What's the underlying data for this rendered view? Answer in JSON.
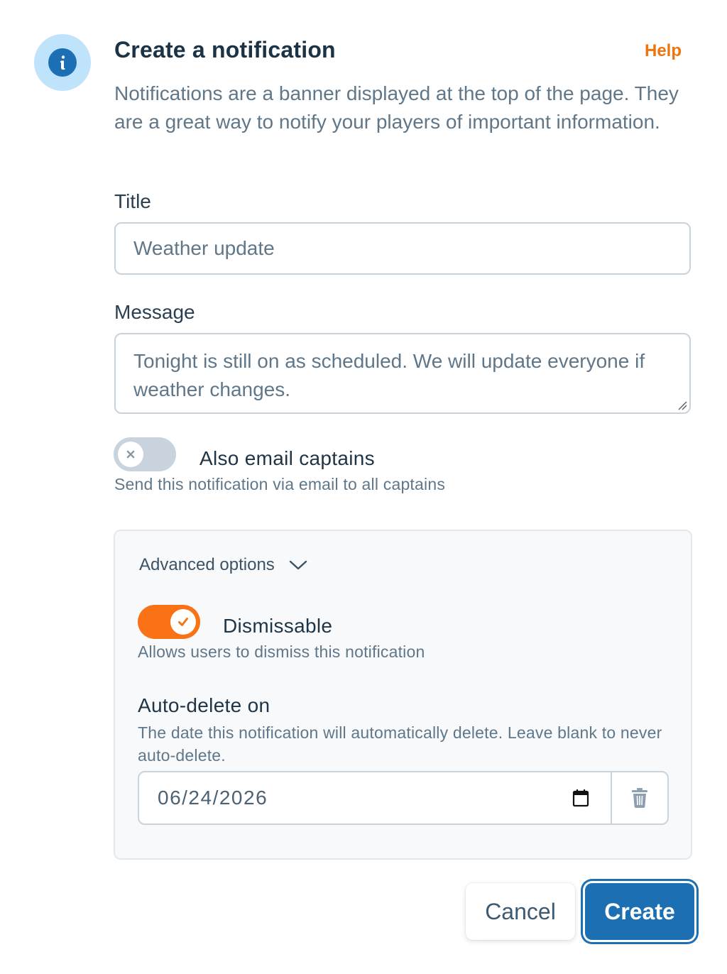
{
  "dialog": {
    "title": "Create a notification",
    "help_label": "Help",
    "intro": "Notifications are a banner displayed at the top of the page. They are a great way to notify your players of important information.",
    "info_icon": "info-icon"
  },
  "form": {
    "title_label": "Title",
    "title_value": "Weather update",
    "message_label": "Message",
    "message_value": "Tonight is still on as scheduled. We will update everyone if weather changes.",
    "email_toggle": {
      "label": "Also email captains",
      "description": "Send this notification via email to all captains",
      "enabled": false
    }
  },
  "advanced": {
    "header": "Advanced options",
    "expanded": true,
    "dismissable": {
      "label": "Dismissable",
      "description": "Allows users to dismiss this notification",
      "enabled": true
    },
    "auto_delete": {
      "label": "Auto-delete on",
      "description": "The date this notification will automatically delete. Leave blank to never auto-delete.",
      "date_value": "06/24/2026"
    }
  },
  "actions": {
    "cancel_label": "Cancel",
    "create_label": "Create"
  },
  "colors": {
    "accent_orange": "#f97316",
    "primary_blue": "#1d6fb3",
    "info_bg": "#bfe3fb"
  }
}
